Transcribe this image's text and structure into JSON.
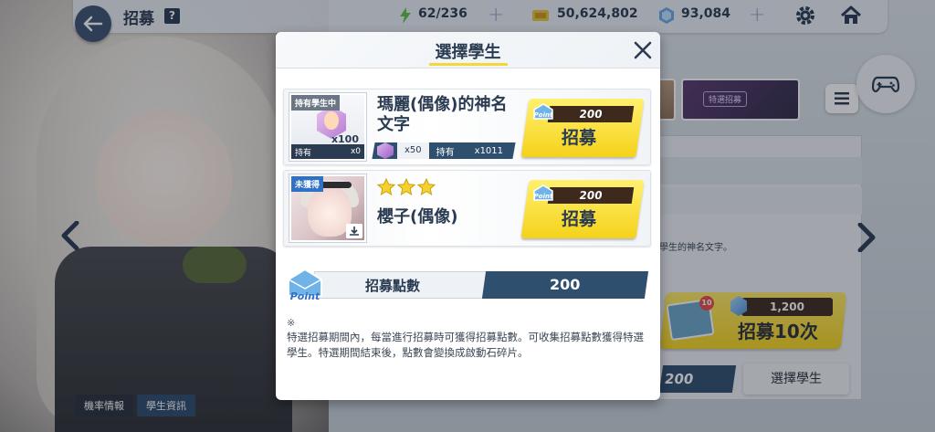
{
  "topbar": {
    "title": "招募",
    "help_icon": "question-icon",
    "stamina": "62/236",
    "credits": "50,624,802",
    "gems": "93,084"
  },
  "background": {
    "info_text": "學生的神名文字。",
    "banner_label": "特選招募",
    "recruit10": {
      "cost": "1,200",
      "label": "招募10次",
      "mail_badge": "10"
    },
    "points_partial": "200",
    "select_student_button": "選擇學生",
    "bottom_tabs": [
      "機率情報",
      "學生資訊"
    ]
  },
  "modal": {
    "title": "選擇學生",
    "cards": [
      {
        "tag": "持有學生中",
        "portrait_qty": "x100",
        "portrait_hold_label": "持有",
        "portrait_hold_value": "x0",
        "name": "瑪麗(偶像)的神名文字",
        "eleph_qty": "x50",
        "hold_label": "持有",
        "hold_value": "x1011",
        "cost": "200",
        "button_label": "招募"
      },
      {
        "tag": "未獲得",
        "stars": 3,
        "name": "櫻子(偶像)",
        "cost": "200",
        "button_label": "招募"
      }
    ],
    "points": {
      "label": "招募點數",
      "value": "200",
      "icon_text": "Point"
    },
    "note_mark": "※",
    "note": "特選招募期間內，每當進行招募時可獲得招募點數。可收集招募點數獲得特選學生。特選期間結束後，點數會變換成啟動石碎片。"
  },
  "colors": {
    "navy": "#2a3b52",
    "button_yellow": "#f5d21a",
    "points_bar": "#2f4f6e",
    "cost_brown": "#3e2a1d",
    "tag_blue": "#2e72c7"
  }
}
